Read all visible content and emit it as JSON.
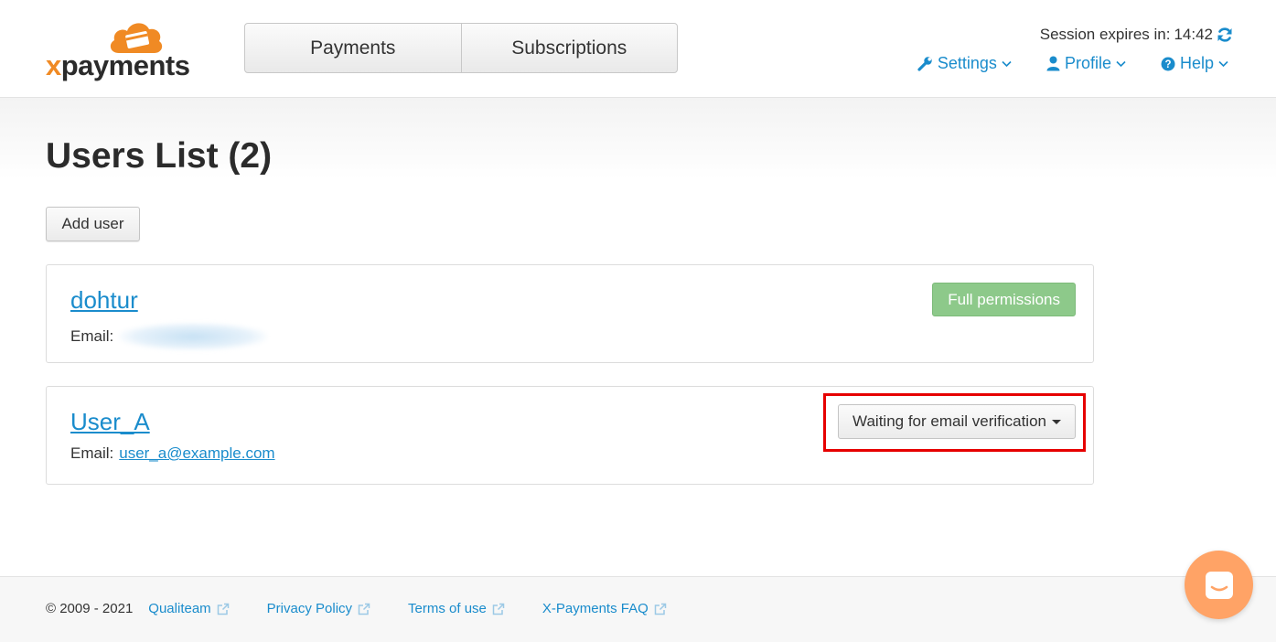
{
  "header": {
    "logo_text": "xpayments",
    "nav_tabs": [
      {
        "label": "Payments"
      },
      {
        "label": "Subscriptions"
      }
    ],
    "session": {
      "label": "Session expires in:",
      "time": "14:42"
    },
    "menu": [
      {
        "label": "Settings",
        "icon": "wrench-icon"
      },
      {
        "label": "Profile",
        "icon": "user-icon"
      },
      {
        "label": "Help",
        "icon": "question-circle-icon"
      }
    ]
  },
  "page": {
    "title": "Users List (2)",
    "add_user_label": "Add user"
  },
  "users": [
    {
      "name": "dohtur",
      "email_label": "Email:",
      "email": "",
      "status": "Full permissions"
    },
    {
      "name": "User_A",
      "email_label": "Email:",
      "email": "user_a@example.com",
      "status": "Waiting for email verification"
    }
  ],
  "footer": {
    "copyright": "© 2009 - 2021",
    "links": [
      {
        "label": "Qualiteam"
      },
      {
        "label": "Privacy Policy"
      },
      {
        "label": "Terms of use"
      },
      {
        "label": "X-Payments FAQ"
      }
    ]
  },
  "colors": {
    "accent": "#1a8ccc",
    "brand_orange": "#f08a24",
    "success": "#8dc98a",
    "highlight": "#e60000",
    "chat": "#ffa366"
  }
}
